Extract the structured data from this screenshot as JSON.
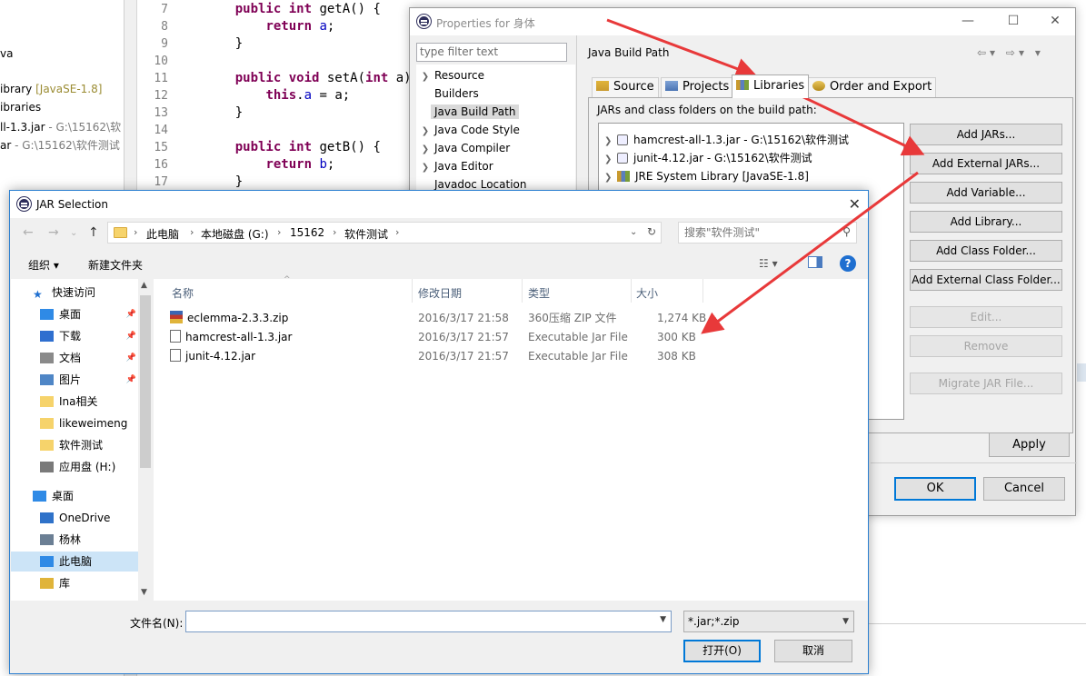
{
  "package_explorer": {
    "rows": [
      {
        "text": "va",
        "dim": ""
      },
      {
        "text": "ibrary ",
        "dim": "[JavaSE-1.8]"
      },
      {
        "text": "ibraries",
        "dim": ""
      },
      {
        "text": "ll-1.3.jar",
        "dim": " - G:\\15162\\软"
      },
      {
        "text": "ar",
        "dim": " - G:\\15162\\软件测试"
      }
    ]
  },
  "editor": {
    "lines": [
      {
        "num": "7",
        "code": "    public int getA() {"
      },
      {
        "num": "8",
        "code": "        return a;"
      },
      {
        "num": "9",
        "code": "    }"
      },
      {
        "num": "10",
        "code": ""
      },
      {
        "num": "11",
        "code": "    public void setA(int a)"
      },
      {
        "num": "12",
        "code": "        this.a = a;"
      },
      {
        "num": "13",
        "code": "    }"
      },
      {
        "num": "14",
        "code": ""
      },
      {
        "num": "15",
        "code": "    public int getB() {"
      },
      {
        "num": "16",
        "code": "        return b;"
      },
      {
        "num": "17",
        "code": "    }"
      }
    ]
  },
  "properties": {
    "title": "Properties for 身体",
    "filter_placeholder": "type filter text",
    "nav": [
      {
        "label": "Resource",
        "arrow": true
      },
      {
        "label": "Builders",
        "arrow": false
      },
      {
        "label": "Java Build Path",
        "arrow": false,
        "selected": true
      },
      {
        "label": "Java Code Style",
        "arrow": true
      },
      {
        "label": "Java Compiler",
        "arrow": true
      },
      {
        "label": "Java Editor",
        "arrow": true
      },
      {
        "label": "Javadoc Location",
        "arrow": false
      }
    ],
    "page_title": "Java Build Path",
    "tabs": [
      "Source",
      "Projects",
      "Libraries",
      "Order and Export"
    ],
    "active_tab": "Libraries",
    "jars_label": "JARs and class folders on the build path:",
    "entries": [
      {
        "label": "hamcrest-all-1.3.jar - G:\\15162\\软件测试",
        "kind": "jar"
      },
      {
        "label": "junit-4.12.jar - G:\\15162\\软件测试",
        "kind": "jar"
      },
      {
        "label": "JRE System Library [JavaSE-1.8]",
        "kind": "jre"
      }
    ],
    "buttons": {
      "add_jars": "Add JARs...",
      "add_external_jars": "Add External JARs...",
      "add_variable": "Add Variable...",
      "add_library": "Add Library...",
      "add_class_folder": "Add Class Folder...",
      "add_external_class_folder": "Add External Class Folder...",
      "edit": "Edit...",
      "remove": "Remove",
      "migrate": "Migrate JAR File...",
      "apply": "Apply",
      "ok": "OK",
      "cancel": "Cancel"
    }
  },
  "jar_dialog": {
    "title": "JAR Selection",
    "breadcrumb": [
      "此电脑",
      "本地磁盘 (G:)",
      "15162",
      "软件测试"
    ],
    "search_placeholder": "搜索\"软件测试\"",
    "toolbar": {
      "organize": "组织 ▾",
      "new_folder": "新建文件夹"
    },
    "sidebar": [
      {
        "label": "快速访问",
        "icon": "star-icon",
        "color": "#1f6fd0",
        "indent": 1,
        "pin": false
      },
      {
        "label": "桌面",
        "icon": "desktop-icon",
        "color": "#2f8ae6",
        "indent": 2,
        "pin": true
      },
      {
        "label": "下载",
        "icon": "download-icon",
        "color": "#2f6fcf",
        "indent": 2,
        "pin": true
      },
      {
        "label": "文档",
        "icon": "document-icon",
        "color": "#8a8a8a",
        "indent": 2,
        "pin": true
      },
      {
        "label": "图片",
        "icon": "pictures-icon",
        "color": "#4f86c6",
        "indent": 2,
        "pin": true
      },
      {
        "label": "Ina相关",
        "icon": "folder-icon",
        "color": "#f6d36b",
        "indent": 2,
        "pin": false
      },
      {
        "label": "likeweimeng",
        "icon": "folder-icon",
        "color": "#f6d36b",
        "indent": 2,
        "pin": false
      },
      {
        "label": "软件测试",
        "icon": "folder-icon",
        "color": "#f6d36b",
        "indent": 2,
        "pin": false
      },
      {
        "label": "应用盘 (H:)",
        "icon": "drive-icon",
        "color": "#7a7a7a",
        "indent": 2,
        "pin": false
      },
      {
        "label": "桌面",
        "icon": "desktop-icon",
        "color": "#2f8ae6",
        "indent": 1,
        "pin": false
      },
      {
        "label": "OneDrive",
        "icon": "cloud-icon",
        "color": "#2f72c9",
        "indent": 2,
        "pin": false
      },
      {
        "label": "杨林",
        "icon": "user-icon",
        "color": "#6b7f94",
        "indent": 2,
        "pin": false
      },
      {
        "label": "此电脑",
        "icon": "computer-icon",
        "color": "#2f8ae6",
        "indent": 2,
        "pin": false,
        "selected": true
      },
      {
        "label": "库",
        "icon": "library-icon",
        "color": "#e0b43a",
        "indent": 2,
        "pin": false
      }
    ],
    "columns": [
      "名称",
      "修改日期",
      "类型",
      "大小"
    ],
    "files": [
      {
        "name": "eclemma-2.3.3.zip",
        "date": "2016/3/17 21:58",
        "type": "360压缩 ZIP 文件",
        "size": "1,274 KB",
        "icon": "zip"
      },
      {
        "name": "hamcrest-all-1.3.jar",
        "date": "2016/3/17 21:57",
        "type": "Executable Jar File",
        "size": "300 KB",
        "icon": "jar"
      },
      {
        "name": "junit-4.12.jar",
        "date": "2016/3/17 21:57",
        "type": "Executable Jar File",
        "size": "308 KB",
        "icon": "jar"
      }
    ],
    "filename_label": "文件名(N):",
    "filename_value": "",
    "filter_value": "*.jar;*.zip",
    "open_label": "打开(O)",
    "cancel_label": "取消"
  },
  "colors": {
    "accent": "#0078d7",
    "annotation_arrow": "#e8393a",
    "keyword": "#7f0055",
    "field": "#0000c0"
  }
}
